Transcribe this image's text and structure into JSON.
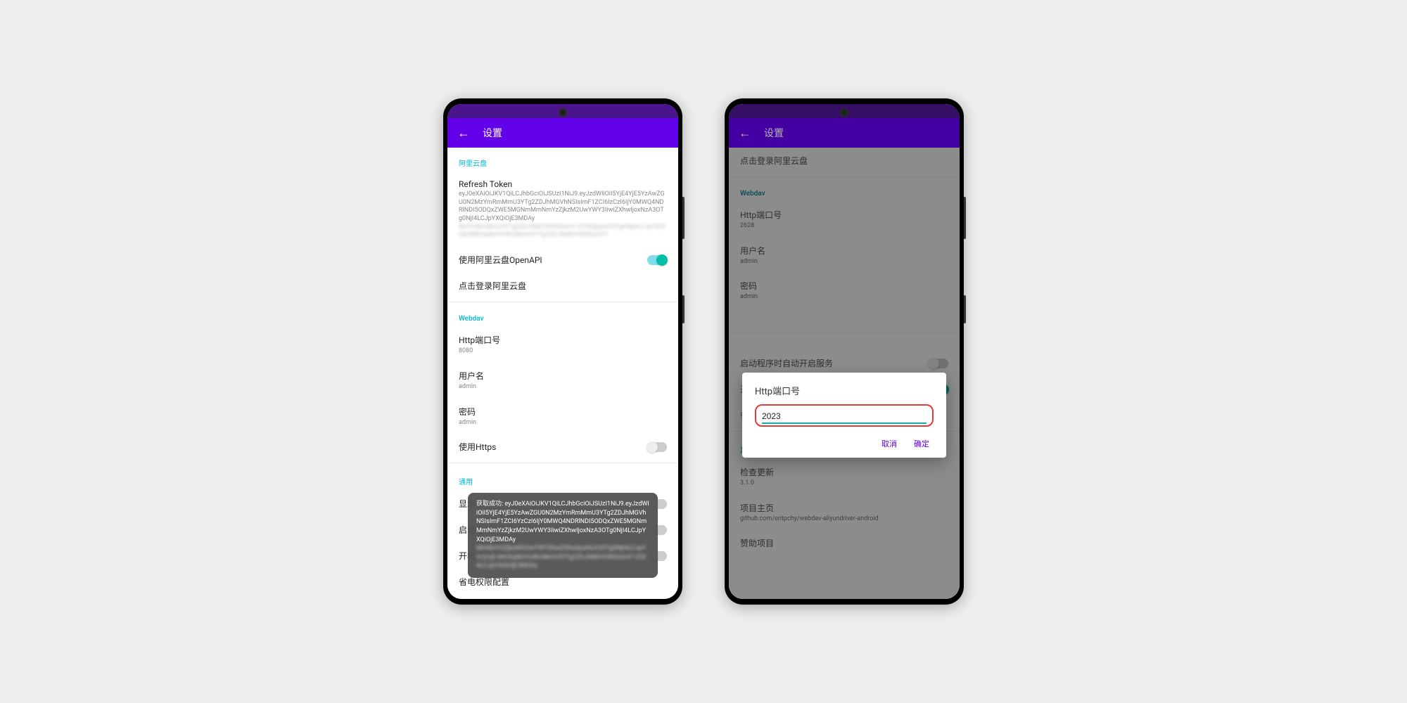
{
  "app": {
    "title": "设置"
  },
  "phone1": {
    "sections": {
      "aliyun": {
        "header": "阿里云盘",
        "refresh_token_label": "Refresh Token",
        "refresh_token_value": "eyJ0eXAiOiJKV1QiLCJhbGciOiJSUzI1NiJ9.eyJzdWIiOiI5YjE4YjE5YzAwZGU0N2MzYmRmMmU3YTg2ZDJhMGVhNSIsImF1ZCI6IzCzI6IjY0MWQ4NDRlNDI5ODQxZWE5MGNmMmNmYzZjkzM2UwYWY3IiwiZXhwIjoxNzA3OTg0NjI4LCJpYXQiOjE3MDAy",
        "use_openapi_label": "使用阿里云盘OpenAPI",
        "login_label": "点击登录阿里云盘"
      },
      "webdav": {
        "header": "Webdav",
        "port_label": "Http端口号",
        "port_value": "8080",
        "user_label": "用户名",
        "user_value": "admin",
        "pass_label": "密码",
        "pass_value": "admin",
        "https_label": "使用Https"
      },
      "general": {
        "header": "通用",
        "show_label": "显示标",
        "autostart_label": "启动标",
        "boot_label": "开机启动服务",
        "battery_label": "省电权限配置"
      }
    },
    "toast": {
      "prefix": "获取成功: ",
      "text": "eyJ0eXAiOiJKV1QiLCJhbGciOiJSUzI1NiJ9.eyJzdWIiOiI5YjE4YjE5YzAwZGU0N2MzYmRmMmU3YTg2ZDJhMGVhNSIsImF1ZCI6YzCzI6IjY0MWQ4NDRlNDI5ODQxZWE5MGNmMmNmYzZjkzM2UwYWY3IiwiZXhwIjoxNzA3OTg0NjI4LCJpYXQiOjE3MDAy"
    }
  },
  "phone2": {
    "login_label": "点击登录阿里云盘",
    "sections": {
      "webdav": {
        "header": "Webdav",
        "port_label": "Http端口号",
        "port_value": "2628",
        "user_label": "用户名",
        "user_value": "admin",
        "pass_label": "密码",
        "pass_value": "admin"
      },
      "general": {
        "autostart_app_label": "启动程序时自动开启服务",
        "boot_label": "开机启动服务",
        "battery_label": "省电权限配置"
      },
      "other": {
        "header": "其他",
        "check_update_label": "检查更新",
        "check_update_value": "3.1.0",
        "project_label": "项目主页",
        "project_value": "github.com/eritpchy/webdav-aliyundriver-android",
        "sponsor_label": "赞助项目"
      }
    },
    "dialog": {
      "title": "Http端口号",
      "value": "2023",
      "cancel": "取消",
      "ok": "确定"
    }
  }
}
